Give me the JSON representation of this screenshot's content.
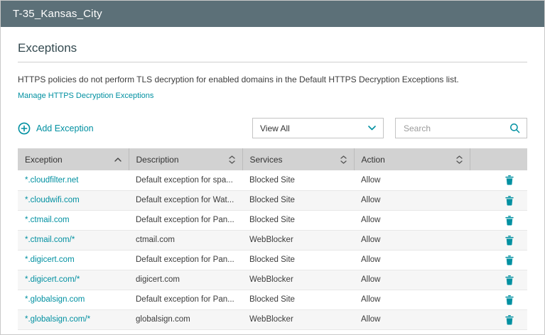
{
  "window": {
    "title": "T-35_Kansas_City"
  },
  "section": {
    "title": "Exceptions"
  },
  "description": "HTTPS policies do not perform TLS decryption for enabled domains in the Default HTTPS Decryption Exceptions list.",
  "manage_link_label": "Manage HTTPS Decryption Exceptions",
  "toolbar": {
    "add_exception_label": "Add Exception",
    "filter_value": "View All",
    "search_placeholder": "Search"
  },
  "icons": {
    "add": "plus-circle-icon",
    "filter": "chevron-down-icon",
    "search": "search-icon",
    "sorted_column": "chevron-up-icon",
    "sortable_column": "sort-arrows-icon",
    "row_action": "trash-icon"
  },
  "table": {
    "columns": [
      {
        "label": "Exception",
        "sort": "asc"
      },
      {
        "label": "Description",
        "sort": "both"
      },
      {
        "label": "Services",
        "sort": "both"
      },
      {
        "label": "Action",
        "sort": "both"
      }
    ],
    "rows": [
      {
        "exception": "*.cloudfilter.net",
        "description": "Default exception for spa...",
        "services": "Blocked Site",
        "action": "Allow"
      },
      {
        "exception": "*.cloudwifi.com",
        "description": "Default exception for Wat...",
        "services": "Blocked Site",
        "action": "Allow"
      },
      {
        "exception": "*.ctmail.com",
        "description": "Default exception for Pan...",
        "services": "Blocked Site",
        "action": "Allow"
      },
      {
        "exception": "*.ctmail.com/*",
        "description": "ctmail.com",
        "services": "WebBlocker",
        "action": "Allow"
      },
      {
        "exception": "*.digicert.com",
        "description": "Default exception for Pan...",
        "services": "Blocked Site",
        "action": "Allow"
      },
      {
        "exception": "*.digicert.com/*",
        "description": "digicert.com",
        "services": "WebBlocker",
        "action": "Allow"
      },
      {
        "exception": "*.globalsign.com",
        "description": "Default exception for Pan...",
        "services": "Blocked Site",
        "action": "Allow"
      },
      {
        "exception": "*.globalsign.com/*",
        "description": "globalsign.com",
        "services": "WebBlocker",
        "action": "Allow"
      }
    ]
  },
  "colors": {
    "accent": "#0090a1",
    "titlebar_bg": "#5c7078",
    "table_header_bg": "#d2d2d2"
  }
}
